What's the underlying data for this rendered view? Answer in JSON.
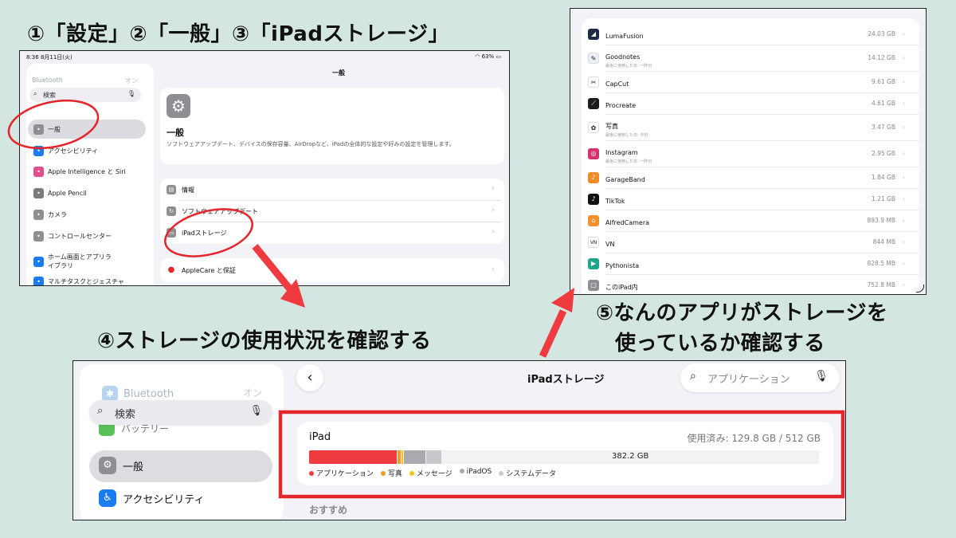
{
  "headings": {
    "step123": "①「設定」②「一般」③「iPadストレージ」",
    "step4": "④ストレージの使用状況を確認する",
    "step5_line1": "⑤なんのアプリがストレージを",
    "step5_line2": "使っているか確認する"
  },
  "shot1": {
    "status_time": "8:36  8月11日(火)",
    "status_right": "63%",
    "bluetooth_label": "Bluetooth",
    "bluetooth_value": "オン",
    "search_placeholder": "検索",
    "sidebar": [
      {
        "label": "一般",
        "icon": "gear-icon",
        "color": "#8e8e93",
        "selected": true
      },
      {
        "label": "アクセシビリティ",
        "icon": "accessibility-icon",
        "color": "#1a7cf0"
      },
      {
        "label": "Apple Intelligence と Siri",
        "icon": "siri-icon",
        "color": "#e0508a"
      },
      {
        "label": "Apple Pencil",
        "icon": "pencil-icon",
        "color": "#7a7a80"
      },
      {
        "label": "カメラ",
        "icon": "camera-icon",
        "color": "#8e8e93"
      },
      {
        "label": "コントロールセンター",
        "icon": "control-center-icon",
        "color": "#8e8e93"
      },
      {
        "label": "ホーム画面とアプリライブラリ",
        "icon": "home-screen-icon",
        "color": "#1a7cf0"
      },
      {
        "label": "マルチタスクとジェスチャ",
        "icon": "multitask-icon",
        "color": "#1a7cf0"
      }
    ],
    "page_title": "一般",
    "general_title": "一般",
    "general_desc": "ソフトウェアアップデート、デバイスの保存容量、AirDropなど、iPadの全体的な設定や好みの設定を管理します。",
    "rows": [
      {
        "label": "情報",
        "icon": "info-icon"
      },
      {
        "label": "ソフトウェアアップデート",
        "icon": "update-icon"
      },
      {
        "label": "iPadストレージ",
        "icon": "storage-icon"
      }
    ],
    "applecare": "AppleCare と保証"
  },
  "shot2": {
    "apps": [
      {
        "name": "LumaFusion",
        "sub": "",
        "size": "24.03 GB",
        "color": "#1f2a44",
        "glyph": "◢"
      },
      {
        "name": "Goodnotes",
        "sub": "最後に使用した日: 一昨日",
        "size": "14.12 GB",
        "color": "#e9eef7",
        "glyph": "✎"
      },
      {
        "name": "CapCut",
        "sub": "",
        "size": "9.61 GB",
        "color": "#ffffff",
        "glyph": "✂"
      },
      {
        "name": "Procreate",
        "sub": "",
        "size": "4.61 GB",
        "color": "#1c1c1e",
        "glyph": "⟋"
      },
      {
        "name": "写真",
        "sub": "最後に使用した日: 今日",
        "size": "3.47 GB",
        "color": "#ffffff",
        "glyph": "✿"
      },
      {
        "name": "Instagram",
        "sub": "最後に使用した日: 一昨日",
        "size": "2.95 GB",
        "color": "#d6336c",
        "glyph": "◎"
      },
      {
        "name": "GarageBand",
        "sub": "",
        "size": "1.84 GB",
        "color": "#f08c28",
        "glyph": "♪"
      },
      {
        "name": "TikTok",
        "sub": "",
        "size": "1.21 GB",
        "color": "#111111",
        "glyph": "♪"
      },
      {
        "name": "AlfredCamera",
        "sub": "",
        "size": "893.9 MB",
        "color": "#f4902b",
        "glyph": "⌂"
      },
      {
        "name": "VN",
        "sub": "",
        "size": "844 MB",
        "color": "#ffffff",
        "glyph": "VN"
      },
      {
        "name": "Pythonista",
        "sub": "",
        "size": "828.5 MB",
        "color": "#1fa58a",
        "glyph": "▶"
      },
      {
        "name": "このiPad内",
        "sub": "",
        "size": "752.8 MB",
        "color": "#8e8e93",
        "glyph": "▢"
      }
    ]
  },
  "shot3": {
    "bluetooth_label": "Bluetooth",
    "bluetooth_value": "オン",
    "search_placeholder": "検索",
    "hidden_item": "バッテリー",
    "sidebar": [
      {
        "label": "一般",
        "icon": "gear-icon",
        "color": "#8e8e93"
      },
      {
        "label": "アクセシビリティ",
        "icon": "accessibility-icon",
        "color": "#1a7cf0"
      }
    ],
    "page_title": "iPadストレージ",
    "app_search_placeholder": "アプリケーション",
    "device": "iPad",
    "used": "使用済み: 129.8 GB / 512 GB",
    "free": "382.2 GB",
    "segments": [
      {
        "name": "アプリケーション",
        "color": "#ef3b40",
        "fraction": 0.172
      },
      {
        "name": "写真",
        "color": "#f39a2b",
        "fraction": 0.007
      },
      {
        "name": "メッセージ",
        "color": "#f5c518",
        "fraction": 0.003
      },
      {
        "name": "iPadOS",
        "color": "#a9a9ae",
        "fraction": 0.042
      },
      {
        "name": "システムデータ",
        "color": "#c9c9cd",
        "fraction": 0.029
      }
    ],
    "recommend": "おすすめ"
  },
  "colors": {
    "accent_red": "#e4252b",
    "background": "#d4e6e2"
  }
}
